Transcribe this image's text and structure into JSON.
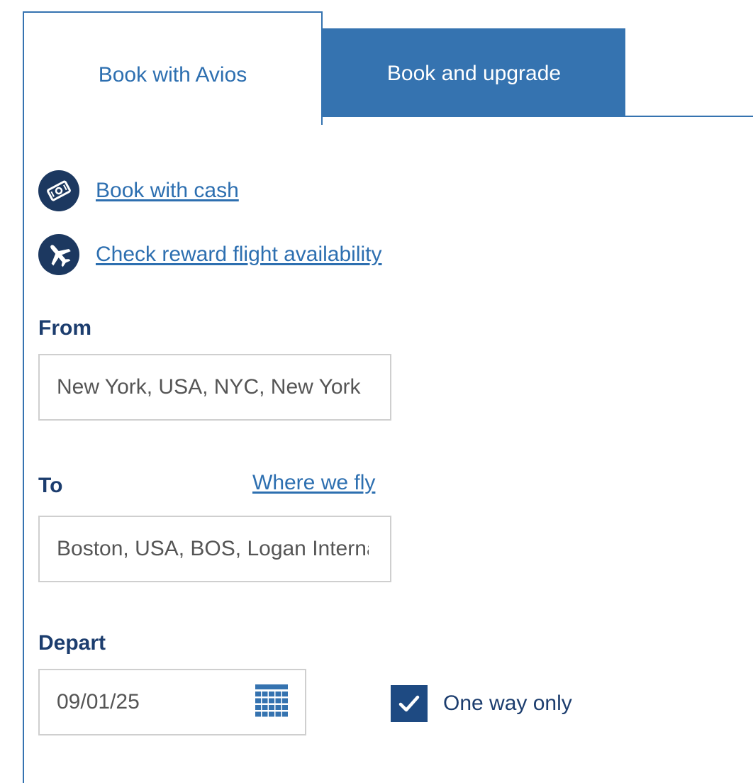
{
  "tabs": {
    "active_label": "Book with Avios",
    "inactive_label": "Book and upgrade"
  },
  "links": {
    "book_with_cash": "Book with cash",
    "check_reward": "Check reward flight availability",
    "where_we_fly": "Where we fly"
  },
  "form": {
    "from_label": "From",
    "from_value": "New York, USA, NYC, New York",
    "to_label": "To",
    "to_value": "Boston, USA, BOS, Logan International",
    "depart_label": "Depart",
    "depart_value": "09/01/25",
    "one_way_label": "One way only",
    "one_way_checked": true
  },
  "colors": {
    "accent": "#3573b0",
    "link": "#2d6fb0",
    "navy": "#1c3860",
    "label": "#1c3d6e"
  },
  "icons": {
    "cash": "cash-icon",
    "plane": "plane-icon",
    "calendar": "calendar-icon",
    "check": "checkmark-icon"
  }
}
